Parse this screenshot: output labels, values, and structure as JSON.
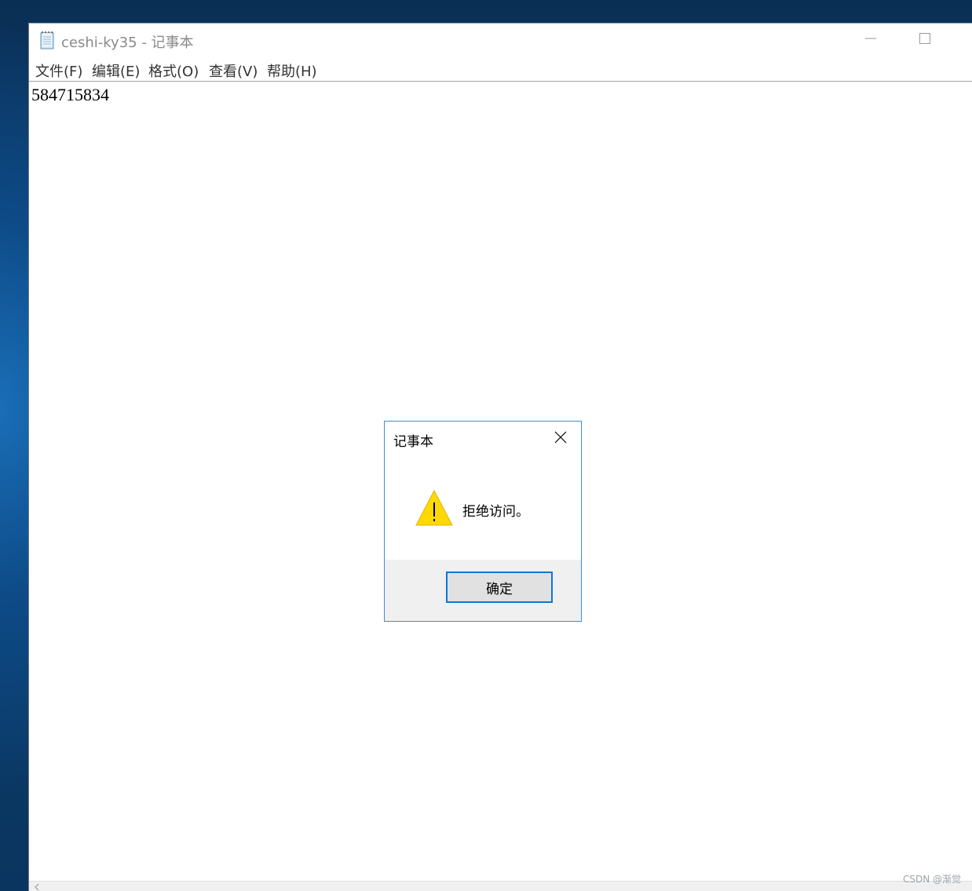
{
  "window": {
    "title": "ceshi-ky35 - 记事本",
    "icon": "notepad-icon",
    "caption_buttons": [
      "minimize-icon",
      "maximize-icon"
    ]
  },
  "menu": {
    "items": [
      {
        "label": "文件(F)"
      },
      {
        "label": "编辑(E)"
      },
      {
        "label": "格式(O)"
      },
      {
        "label": "查看(V)"
      },
      {
        "label": "帮助(H)"
      }
    ]
  },
  "editor": {
    "content": "584715834"
  },
  "dialog": {
    "title": "记事本",
    "message": "拒绝访问。",
    "icon": "warning-icon",
    "ok_label": "确定",
    "close_icon": "close-icon"
  },
  "watermark": "CSDN @渐觉",
  "colors": {
    "dialog_border": "#3c8dd6",
    "ok_button_border": "#0a78d7",
    "warning_yellow": "#ffd800"
  }
}
